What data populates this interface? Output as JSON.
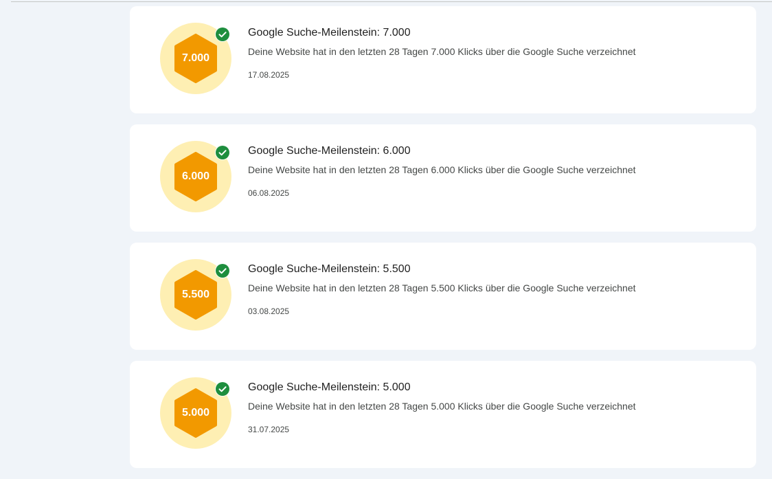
{
  "colors": {
    "background": "#f0f4f9",
    "card": "#ffffff",
    "badge_circle": "#feefb3",
    "hexagon": "#f29900",
    "check": "#1e8e3e"
  },
  "milestones": [
    {
      "badge_value": "7.000",
      "title": "Google Suche-Meilenstein: 7.000",
      "description": "Deine Website hat in den letzten 28 Tagen 7.000 Klicks über die Google Suche verzeichnet",
      "date": "17.08.2025",
      "achieved": true
    },
    {
      "badge_value": "6.000",
      "title": "Google Suche-Meilenstein: 6.000",
      "description": "Deine Website hat in den letzten 28 Tagen 6.000 Klicks über die Google Suche verzeichnet",
      "date": "06.08.2025",
      "achieved": true
    },
    {
      "badge_value": "5.500",
      "title": "Google Suche-Meilenstein: 5.500",
      "description": "Deine Website hat in den letzten 28 Tagen 5.500 Klicks über die Google Suche verzeichnet",
      "date": "03.08.2025",
      "achieved": true
    },
    {
      "badge_value": "5.000",
      "title": "Google Suche-Meilenstein: 5.000",
      "description": "Deine Website hat in den letzten 28 Tagen 5.000 Klicks über die Google Suche verzeichnet",
      "date": "31.07.2025",
      "achieved": true
    }
  ]
}
